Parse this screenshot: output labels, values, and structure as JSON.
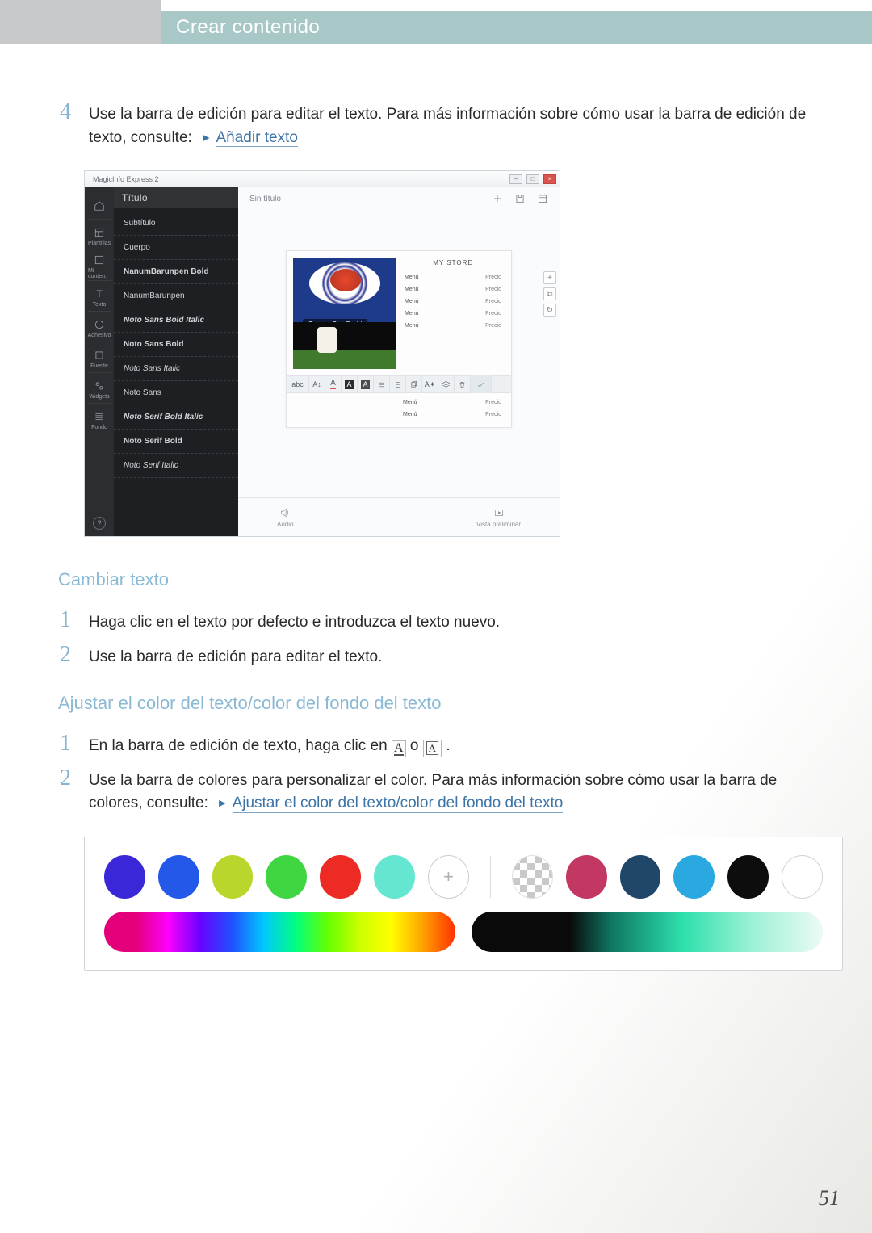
{
  "header": {
    "title": "Crear contenido"
  },
  "step4": {
    "num": "4",
    "text": "Use la barra de edición para editar el texto. Para más información sobre cómo usar la barra de edición de texto, consulte:",
    "link": "Añadir texto"
  },
  "screenshot": {
    "windowTitle": "MagicInfo Express 2",
    "panelTitle": "Título",
    "panelItems": [
      {
        "label": "Subtítulo",
        "cls": ""
      },
      {
        "label": "Cuerpo",
        "cls": ""
      },
      {
        "label": "NanumBarunpen Bold",
        "cls": "b"
      },
      {
        "label": "NanumBarunpen",
        "cls": ""
      },
      {
        "label": "Noto Sans Bold Italic",
        "cls": "bi"
      },
      {
        "label": "Noto Sans Bold",
        "cls": "b"
      },
      {
        "label": "Noto Sans Italic",
        "cls": "i"
      },
      {
        "label": "Noto Sans",
        "cls": ""
      },
      {
        "label": "Noto Serif Bold Italic",
        "cls": "bi"
      },
      {
        "label": "Noto Serif Bold",
        "cls": "b"
      },
      {
        "label": "Noto Serif Italic",
        "cls": "i"
      }
    ],
    "nav": [
      "",
      "Plantillas",
      "Mi conten.",
      "Texto",
      "Adhesivo",
      "Fuente",
      "Widgets",
      "Fondo"
    ],
    "canvasTitle": "Sin título",
    "boardTitle": "MY STORE",
    "caption": "Salmon Roe Sushi",
    "menuLeft": "Menú",
    "menuRight": "Precio",
    "toolbarAbc": "abc",
    "bottomLeft": "Audio",
    "bottomRight": "Vista preliminar"
  },
  "section1": {
    "heading": "Cambiar texto",
    "s1": {
      "num": "1",
      "text": "Haga clic en el texto por defecto e introduzca el texto nuevo."
    },
    "s2": {
      "num": "2",
      "text": "Use la barra de edición para editar el texto."
    }
  },
  "section2": {
    "heading": "Ajustar el color del texto/color del fondo del texto",
    "s1": {
      "num": "1",
      "pre": "En la barra de edición de texto, haga clic en",
      "mid": "o",
      "post": "."
    },
    "s2": {
      "num": "2",
      "text": "Use la barra de colores para personalizar el color. Para más información sobre cómo usar la barra de colores, consulte:",
      "link": "Ajustar el color del texto/color del fondo del texto"
    }
  },
  "swatches": [
    "#3a28d8",
    "#2458e8",
    "#b9d62c",
    "#3fd641",
    "#ed2a24",
    "#64e6d0"
  ],
  "swatches2": [
    "#c23863",
    "#20466a",
    "#2aa9e0",
    "#0d0d0d"
  ],
  "pageNumber": "51"
}
